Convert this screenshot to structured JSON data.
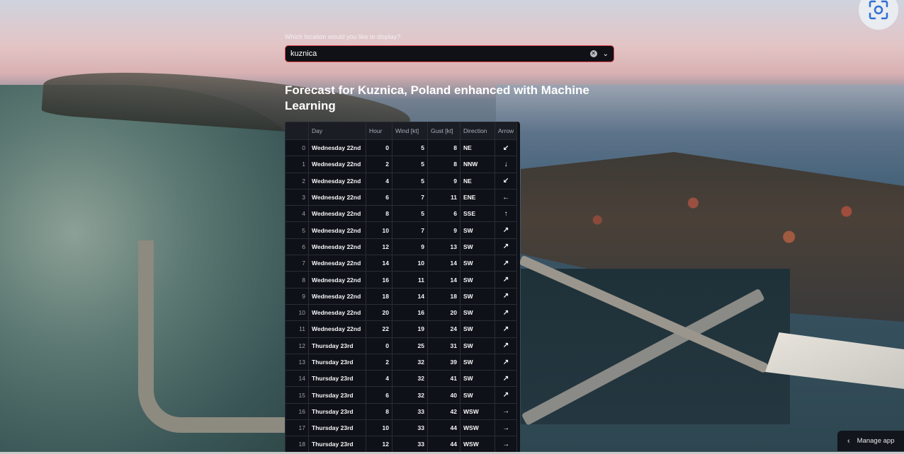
{
  "select_label": "Which location would you like to display?",
  "select_value": "kuznica",
  "title": "Forecast for Kuznica, Poland enhanced with Machine Learning",
  "manage_app": "Manage app",
  "table": {
    "headers": [
      "",
      "Day",
      "Hour",
      "Wind [kt]",
      "Gust [kt]",
      "Direction",
      "Arrow"
    ],
    "rows": [
      [
        "0",
        "Wednesday 22nd",
        "0",
        "5",
        "8",
        "NE",
        "↙"
      ],
      [
        "1",
        "Wednesday 22nd",
        "2",
        "5",
        "8",
        "NNW",
        "↓"
      ],
      [
        "2",
        "Wednesday 22nd",
        "4",
        "5",
        "9",
        "NE",
        "↙"
      ],
      [
        "3",
        "Wednesday 22nd",
        "6",
        "7",
        "11",
        "ENE",
        "←"
      ],
      [
        "4",
        "Wednesday 22nd",
        "8",
        "5",
        "6",
        "SSE",
        "↑"
      ],
      [
        "5",
        "Wednesday 22nd",
        "10",
        "7",
        "9",
        "SW",
        "↗"
      ],
      [
        "6",
        "Wednesday 22nd",
        "12",
        "9",
        "13",
        "SW",
        "↗"
      ],
      [
        "7",
        "Wednesday 22nd",
        "14",
        "10",
        "14",
        "SW",
        "↗"
      ],
      [
        "8",
        "Wednesday 22nd",
        "16",
        "11",
        "14",
        "SW",
        "↗"
      ],
      [
        "9",
        "Wednesday 22nd",
        "18",
        "14",
        "18",
        "SW",
        "↗"
      ],
      [
        "10",
        "Wednesday 22nd",
        "20",
        "16",
        "20",
        "SW",
        "↗"
      ],
      [
        "11",
        "Wednesday 22nd",
        "22",
        "19",
        "24",
        "SW",
        "↗"
      ],
      [
        "12",
        "Thursday 23rd",
        "0",
        "25",
        "31",
        "SW",
        "↗"
      ],
      [
        "13",
        "Thursday 23rd",
        "2",
        "32",
        "39",
        "SW",
        "↗"
      ],
      [
        "14",
        "Thursday 23rd",
        "4",
        "32",
        "41",
        "SW",
        "↗"
      ],
      [
        "15",
        "Thursday 23rd",
        "6",
        "32",
        "40",
        "SW",
        "↗"
      ],
      [
        "16",
        "Thursday 23rd",
        "8",
        "33",
        "42",
        "WSW",
        "→"
      ],
      [
        "17",
        "Thursday 23rd",
        "10",
        "33",
        "44",
        "WSW",
        "→"
      ],
      [
        "18",
        "Thursday 23rd",
        "12",
        "33",
        "44",
        "WSW",
        "→"
      ]
    ]
  },
  "colors": {
    "accent": "#e0434b",
    "table_bg": "#0e1117"
  }
}
